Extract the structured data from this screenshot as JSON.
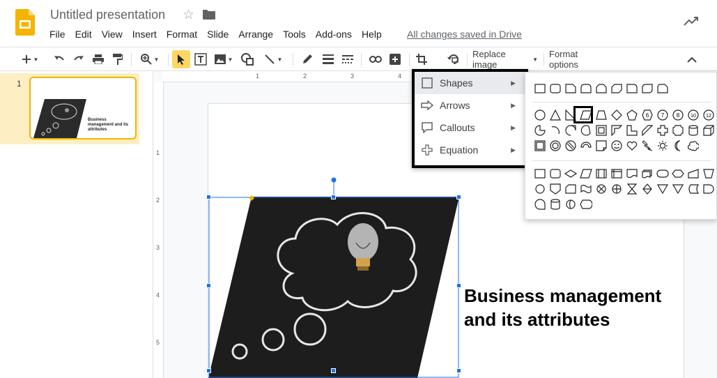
{
  "app": {
    "title": "Untitled presentation",
    "saved_status": "All changes saved in Drive"
  },
  "menubar": [
    "File",
    "Edit",
    "View",
    "Insert",
    "Format",
    "Slide",
    "Arrange",
    "Tools",
    "Add-ons",
    "Help"
  ],
  "toolbar": {
    "replace_image_label": "Replace image",
    "format_options_label": "Format options"
  },
  "filmstrip": {
    "slide_number": "1",
    "thumb_text": "Business management and its attributes"
  },
  "ruler": {
    "h_labels": [
      "1",
      "2",
      "3",
      "4"
    ],
    "v_labels": [
      "1",
      "2",
      "3",
      "4",
      "5"
    ]
  },
  "slide": {
    "title": "Business management and its attributes"
  },
  "shape_menu": {
    "items": [
      {
        "label": "Shapes",
        "icon": "square-icon"
      },
      {
        "label": "Arrows",
        "icon": "arrow-icon"
      },
      {
        "label": "Callouts",
        "icon": "callout-icon"
      },
      {
        "label": "Equation",
        "icon": "plus-icon"
      }
    ]
  },
  "shape_panel": {
    "equation_numbers": [
      "6",
      "7",
      "8",
      "10",
      "12"
    ]
  },
  "colors": {
    "accent": "#1a73e8",
    "slide_select": "#f4b400",
    "menu_hover": "#e8eaed",
    "crop_active": "#fdd663"
  }
}
